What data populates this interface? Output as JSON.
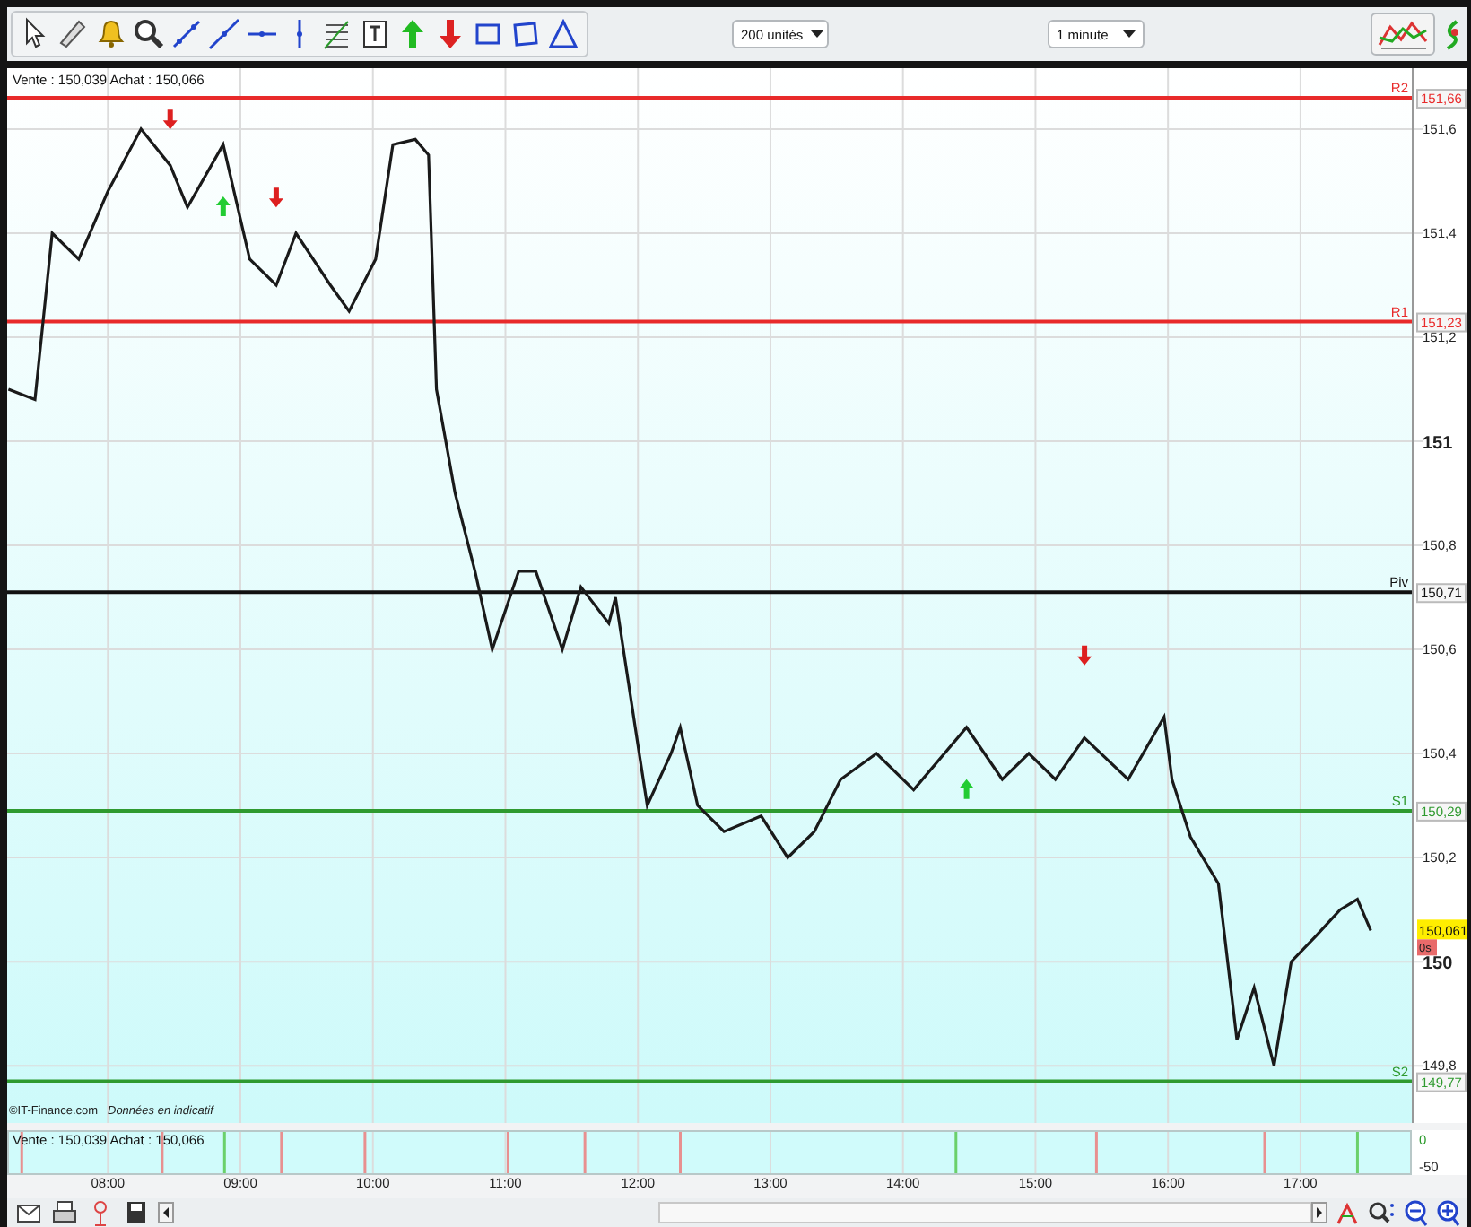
{
  "toolbar": {
    "tools": [
      {
        "kind": "pointer"
      },
      {
        "kind": "ruler"
      },
      {
        "kind": "bell"
      },
      {
        "kind": "magnifier"
      },
      {
        "kind": "diagonal"
      },
      {
        "kind": "segment"
      },
      {
        "kind": "horizontal"
      },
      {
        "kind": "vertical"
      },
      {
        "kind": "fibo"
      },
      {
        "kind": "text"
      },
      {
        "kind": "buy"
      },
      {
        "kind": "sell"
      },
      {
        "kind": "rectangle"
      },
      {
        "kind": "polygon"
      },
      {
        "kind": "triangle"
      }
    ],
    "dropdowns": [
      {
        "value": "200 unités"
      },
      {
        "value": "1 minute"
      }
    ]
  },
  "chart": {
    "quote": "Vente : 150,039 Achat : 150,066",
    "source": "©IT-Finance.com",
    "disclaimer": "Données en indicatif",
    "current_price": "150,061",
    "countdown": "0s",
    "level_badges": [
      "151,66",
      "151,23",
      "150,71",
      "150,29",
      "149,77"
    ],
    "chart_data": {
      "type": "line",
      "grid": true,
      "xlim": [
        7.24,
        17.84
      ],
      "ylim": [
        149.69,
        151.717
      ],
      "xticks": [
        {
          "value": 8,
          "label": "08:00"
        },
        {
          "value": 9,
          "label": "09:00"
        },
        {
          "value": 10,
          "label": "10:00"
        },
        {
          "value": 11,
          "label": "11:00"
        },
        {
          "value": 12,
          "label": "12:00"
        },
        {
          "value": 13,
          "label": "13:00"
        },
        {
          "value": 14,
          "label": "14:00"
        },
        {
          "value": 15,
          "label": "15:00"
        },
        {
          "value": 16,
          "label": "16:00"
        },
        {
          "value": 17,
          "label": "17:00"
        }
      ],
      "yticks": [
        {
          "value": 149.8,
          "label": "149,8"
        },
        {
          "value": 150,
          "label": "150"
        },
        {
          "value": 150.2,
          "label": "150,2"
        },
        {
          "value": 150.4,
          "label": "150,4"
        },
        {
          "value": 150.6,
          "label": "150,6"
        },
        {
          "value": 150.8,
          "label": "150,8"
        },
        {
          "value": 151,
          "label": "151"
        },
        {
          "value": 151.2,
          "label": "151,2"
        },
        {
          "value": 151.4,
          "label": "151,4"
        },
        {
          "value": 151.6,
          "label": "151,6"
        }
      ],
      "x": [
        7.25,
        7.45,
        7.58,
        7.78,
        8.0,
        8.25,
        8.47,
        8.6,
        8.87,
        9.07,
        9.27,
        9.42,
        9.68,
        9.82,
        10.02,
        10.15,
        10.32,
        10.42,
        10.48,
        10.62,
        10.77,
        10.9,
        11.1,
        11.23,
        11.43,
        11.57,
        11.78,
        11.83,
        11.98,
        12.07,
        12.25,
        12.32,
        12.45,
        12.65,
        12.93,
        13.13,
        13.33,
        13.53,
        13.8,
        14.08,
        14.48,
        14.75,
        14.95,
        15.15,
        15.37,
        15.7,
        15.97,
        16.03,
        16.17,
        16.38,
        16.52,
        16.65,
        16.8,
        16.93,
        17.12,
        17.3,
        17.43,
        17.53
      ],
      "series": [
        {
          "color": "#1a1a1a",
          "values": [
            151.1,
            151.08,
            151.4,
            151.35,
            151.48,
            151.6,
            151.53,
            151.45,
            151.57,
            151.35,
            151.3,
            151.4,
            151.3,
            151.25,
            151.35,
            151.57,
            151.58,
            151.55,
            151.1,
            150.9,
            150.75,
            150.6,
            150.75,
            150.75,
            150.6,
            150.72,
            150.65,
            150.7,
            150.45,
            150.3,
            150.4,
            150.45,
            150.3,
            150.25,
            150.28,
            150.2,
            150.25,
            150.35,
            150.4,
            150.33,
            150.45,
            150.35,
            150.4,
            150.35,
            150.43,
            150.35,
            150.47,
            150.35,
            150.24,
            150.15,
            149.85,
            149.95,
            149.8,
            150.0,
            150.05,
            150.1,
            150.12,
            150.06
          ]
        },
        {
          "type": "scatter",
          "color": "#dd2020",
          "values": [
            null,
            null,
            null,
            null,
            null,
            null,
            151.62,
            null,
            null,
            null,
            151.47,
            null,
            null,
            null,
            null,
            null,
            null,
            null,
            null,
            null,
            null,
            null,
            null,
            null,
            null,
            null,
            null,
            null,
            null,
            null,
            null,
            null,
            null,
            null,
            null,
            null,
            null,
            null,
            null,
            null,
            null,
            null,
            null,
            null,
            150.59,
            null,
            null,
            null,
            null,
            null,
            null,
            null,
            null,
            null,
            null,
            null,
            null,
            null
          ]
        },
        {
          "type": "scatter",
          "color": "#22cc33",
          "values": [
            null,
            null,
            null,
            null,
            null,
            null,
            null,
            null,
            151.45,
            null,
            null,
            null,
            null,
            null,
            null,
            null,
            null,
            null,
            null,
            null,
            null,
            null,
            null,
            null,
            null,
            null,
            null,
            null,
            null,
            null,
            null,
            null,
            null,
            null,
            null,
            null,
            null,
            null,
            null,
            null,
            150.33,
            null,
            null,
            null,
            null,
            null,
            null,
            null,
            null,
            null,
            null,
            null,
            null,
            null,
            null,
            null,
            null,
            null
          ]
        }
      ],
      "ref_lines": [
        {
          "axis": "y",
          "value": 151.66,
          "label": "R2",
          "color": "#e82a2a"
        },
        {
          "axis": "y",
          "value": 151.23,
          "label": "R1",
          "color": "#e82a2a"
        },
        {
          "axis": "y",
          "value": 150.71,
          "label": "Piv",
          "color": "#111111"
        },
        {
          "axis": "y",
          "value": 150.29,
          "label": "S1",
          "color": "#2f9a2f"
        },
        {
          "axis": "y",
          "value": 149.77,
          "label": "S2",
          "color": "#2f9a2f"
        }
      ]
    }
  },
  "signal_panel": {
    "quote": "Vente : 150,039 Achat : 150,066",
    "chart_data": {
      "type": "bar",
      "grid": true,
      "stacked": true,
      "xlim": [
        7.24,
        17.84
      ],
      "ylim": [
        -60,
        10
      ],
      "yticks": [
        {
          "value": 0,
          "label": "0"
        },
        {
          "value": -50,
          "label": "-50"
        }
      ],
      "x": [
        7.35,
        8.41,
        8.88,
        9.31,
        9.94,
        11.02,
        11.6,
        12.32,
        14.4,
        15.46,
        16.73,
        17.43
      ],
      "series": [
        {
          "color": "#6bd06b",
          "values": [
            null,
            null,
            1,
            null,
            null,
            null,
            null,
            null,
            1,
            null,
            null,
            1
          ]
        },
        {
          "color": "#e89090",
          "values": [
            1,
            1,
            null,
            1,
            1,
            1,
            1,
            1,
            null,
            1,
            1,
            null
          ]
        }
      ]
    }
  },
  "bottom_bar": {
    "tools": [
      {
        "kind": "mail"
      },
      {
        "kind": "printer"
      },
      {
        "kind": "pin"
      },
      {
        "kind": "save"
      }
    ]
  }
}
